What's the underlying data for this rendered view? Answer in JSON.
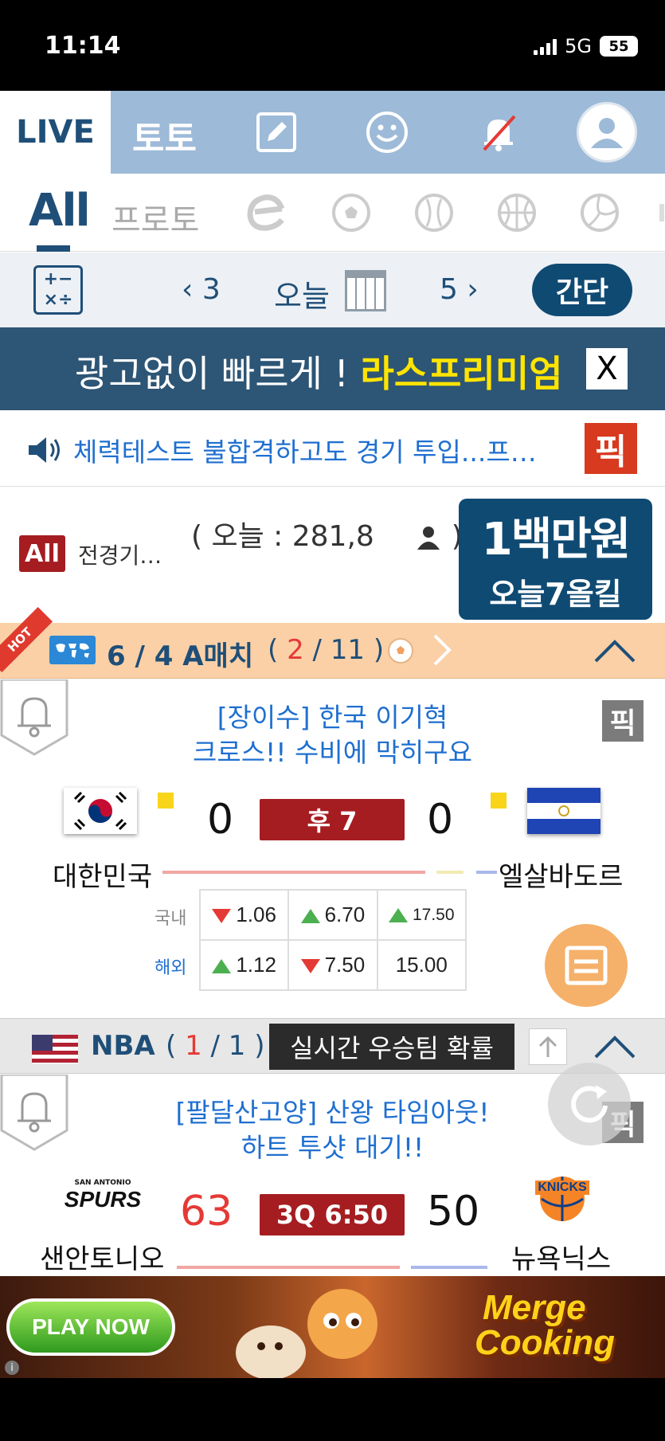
{
  "status_bar": {
    "time": "11:14",
    "network": "5G",
    "battery": "55"
  },
  "top_nav": {
    "live": "LIVE",
    "toto": "토토",
    "icons": [
      "edit-icon",
      "smile-icon",
      "bell-muted-icon",
      "profile-icon"
    ]
  },
  "sports_tabs": {
    "all": "All",
    "proto": "프로토",
    "icons": [
      "esports-icon",
      "soccer-icon",
      "baseball-icon",
      "basketball-icon",
      "volleyball-icon"
    ]
  },
  "date_bar": {
    "prev": "3",
    "today": "오늘",
    "next": "5",
    "simple": "간단"
  },
  "ad_banner": {
    "text": "광고없이 빠르게 ! ",
    "highlight": "라스프리미엄",
    "close": "X"
  },
  "ticker": {
    "text": "체력테스트 불합격하고도 경기 투입...프…",
    "pick": "픽"
  },
  "count_row": {
    "badge": "All",
    "all_games": "전경기…",
    "count_text": "( 오늘 : 281,8",
    "count_suffix": ")",
    "promo_line1": "1백만원",
    "promo_line2": "오늘7올킬"
  },
  "match_section": {
    "hot": "HOT",
    "title": "6 / 4  A매치",
    "count_open": "( ",
    "live_count": "2",
    "count_rest": " / 11 )"
  },
  "match1": {
    "headline_1": "[장이수] 한국 이기혁",
    "headline_2": "크로스!! 수비에 막히구요",
    "pick": "픽",
    "home_team": "대한민국",
    "away_team": "엘살바도르",
    "home_score": "0",
    "away_score": "0",
    "status": "후 7",
    "odds_labels": [
      "국내",
      "해외"
    ],
    "odds": [
      {
        "home": "1.06",
        "home_dir": "down",
        "draw": "6.70",
        "draw_dir": "up",
        "away": "17.50",
        "away_dir": "up"
      },
      {
        "home": "1.12",
        "home_dir": "up",
        "draw": "7.50",
        "draw_dir": "down",
        "away": "15.00",
        "away_dir": "none"
      }
    ]
  },
  "nba_section": {
    "title": "NBA",
    "count_open": "( ",
    "live_count": "1",
    "count_rest": " / 1 )",
    "live_prob": "실시간 우승팀 확률"
  },
  "match2": {
    "headline_1": "[팔달산고양] 산왕 타임아웃!",
    "headline_2": "하트 투샷 대기!!",
    "pick": "픽",
    "home_team": "샌안토니오",
    "away_team": "뉴욕닉스",
    "home_logo": "SPURS",
    "home_logo_top": "SAN ANTONIO",
    "away_logo": "KNICKS",
    "home_score": "63",
    "away_score": "50",
    "status": "3Q 6:50"
  },
  "game_ad": {
    "play": "PLAY NOW",
    "logo_1": "Merge",
    "logo_2": "Cooking",
    "info": "i"
  },
  "colors": {
    "brand_navy": "#1f4f78",
    "live_red": "#a51d21",
    "accent_yellow": "#ffe400",
    "hot_orange": "#fbd0a6"
  }
}
